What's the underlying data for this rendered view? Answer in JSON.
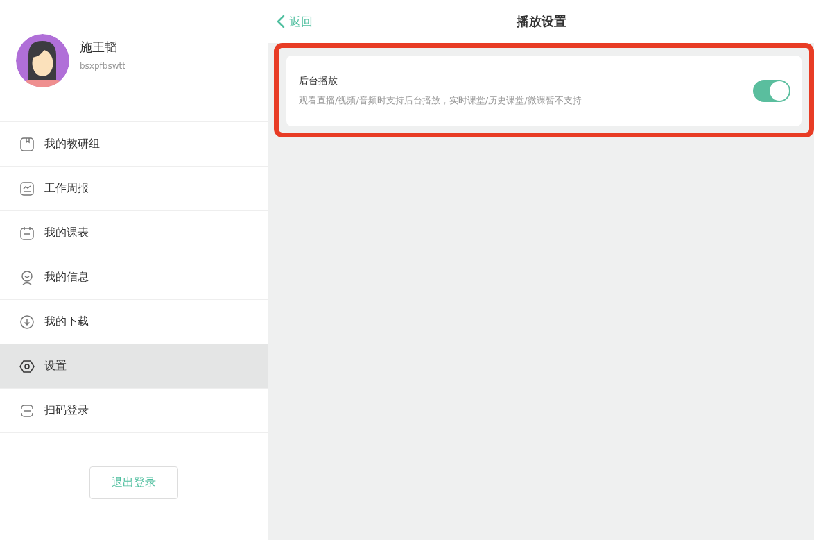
{
  "profile": {
    "name": "施王韬",
    "account": "bsxpfbswtt"
  },
  "menu": [
    {
      "kind": "group",
      "label": "我的教研组",
      "selected": false
    },
    {
      "kind": "report",
      "label": "工作周报",
      "selected": false
    },
    {
      "kind": "schedule",
      "label": "我的课表",
      "selected": false
    },
    {
      "kind": "info",
      "label": "我的信息",
      "selected": false
    },
    {
      "kind": "download",
      "label": "我的下载",
      "selected": false
    },
    {
      "kind": "settings",
      "label": "设置",
      "selected": true
    },
    {
      "kind": "scan",
      "label": "扫码登录",
      "selected": false
    }
  ],
  "logout_button": "退出登录",
  "header": {
    "back": "返回",
    "title": "播放设置"
  },
  "settings": [
    {
      "title": "后台播放",
      "description": "观看直播/视频/音频时支持后台播放，实时课堂/历史课堂/微课暂不支持",
      "on": true,
      "highlighted": true
    }
  ]
}
